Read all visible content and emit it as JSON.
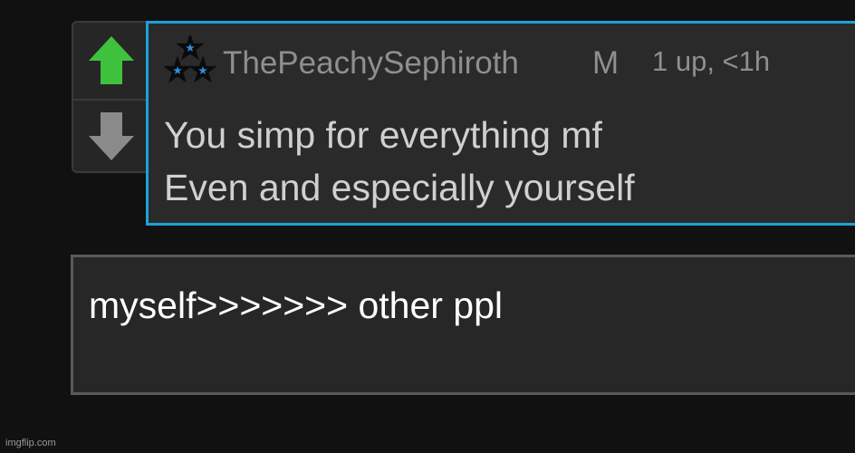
{
  "vote": {
    "up_icon": "arrow-up-icon",
    "down_icon": "arrow-down-icon",
    "up_color": "#3ec23e",
    "down_color": "#8a8a8a"
  },
  "comment": {
    "user_icon": "stars-icon",
    "username": "ThePeachySephiroth",
    "badge": "M",
    "meta": "1 up, <1h",
    "lines": [
      "You simp for everything mf",
      "Even and especially yourself"
    ],
    "border_color": "#1aa3d6"
  },
  "reply": {
    "value": "myself>>>>>>> other ppl"
  },
  "watermark": "imgflip.com"
}
